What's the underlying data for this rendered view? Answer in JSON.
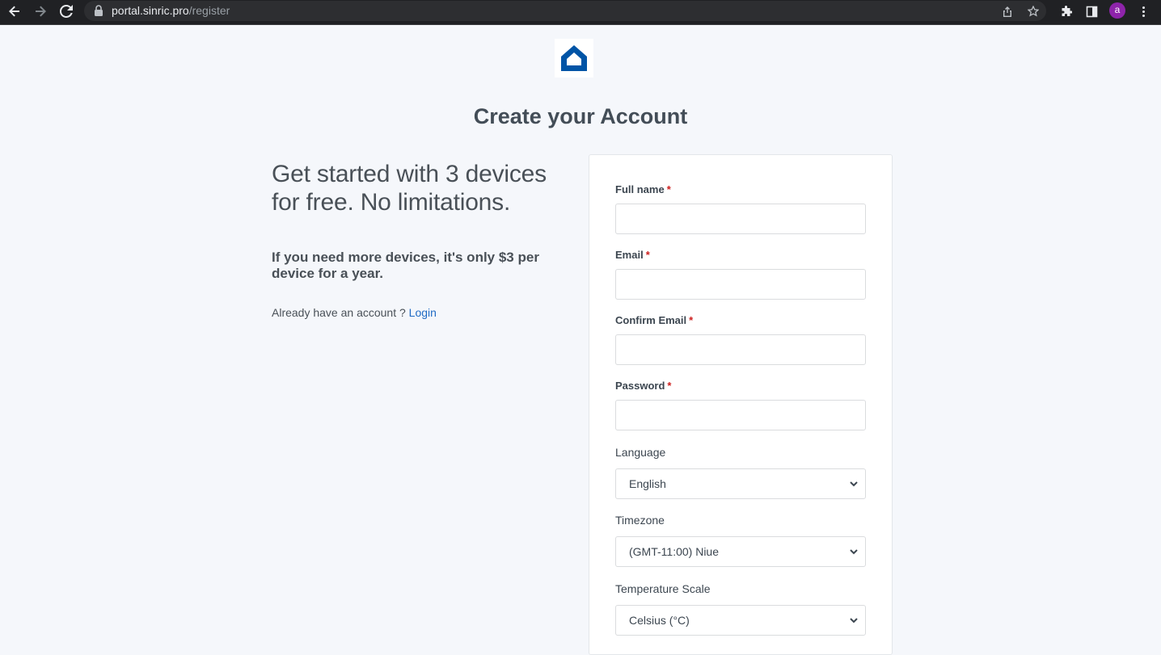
{
  "browser": {
    "url_host": "portal.sinric.pro",
    "url_path": "/register",
    "profile_initial": "a"
  },
  "page": {
    "title": "Create your Account",
    "headline": "Get started with 3 devices for free. No limitations.",
    "subline": "If you need more devices, it's only $3 per device for a year.",
    "login_prompt": "Already have an account ?",
    "login_link": "Login"
  },
  "form": {
    "full_name_label": "Full name",
    "email_label": "Email",
    "confirm_email_label": "Confirm Email",
    "password_label": "Password",
    "required_mark": "*",
    "language_label": "Language",
    "language_value": "English",
    "timezone_label": "Timezone",
    "timezone_value": "(GMT-11:00) Niue",
    "temperature_label": "Temperature Scale",
    "temperature_value": "Celsius (°C)"
  },
  "colors": {
    "brand": "#0054a6",
    "link": "#206bc4",
    "required": "#cd201f",
    "background": "#f5f7fb"
  }
}
